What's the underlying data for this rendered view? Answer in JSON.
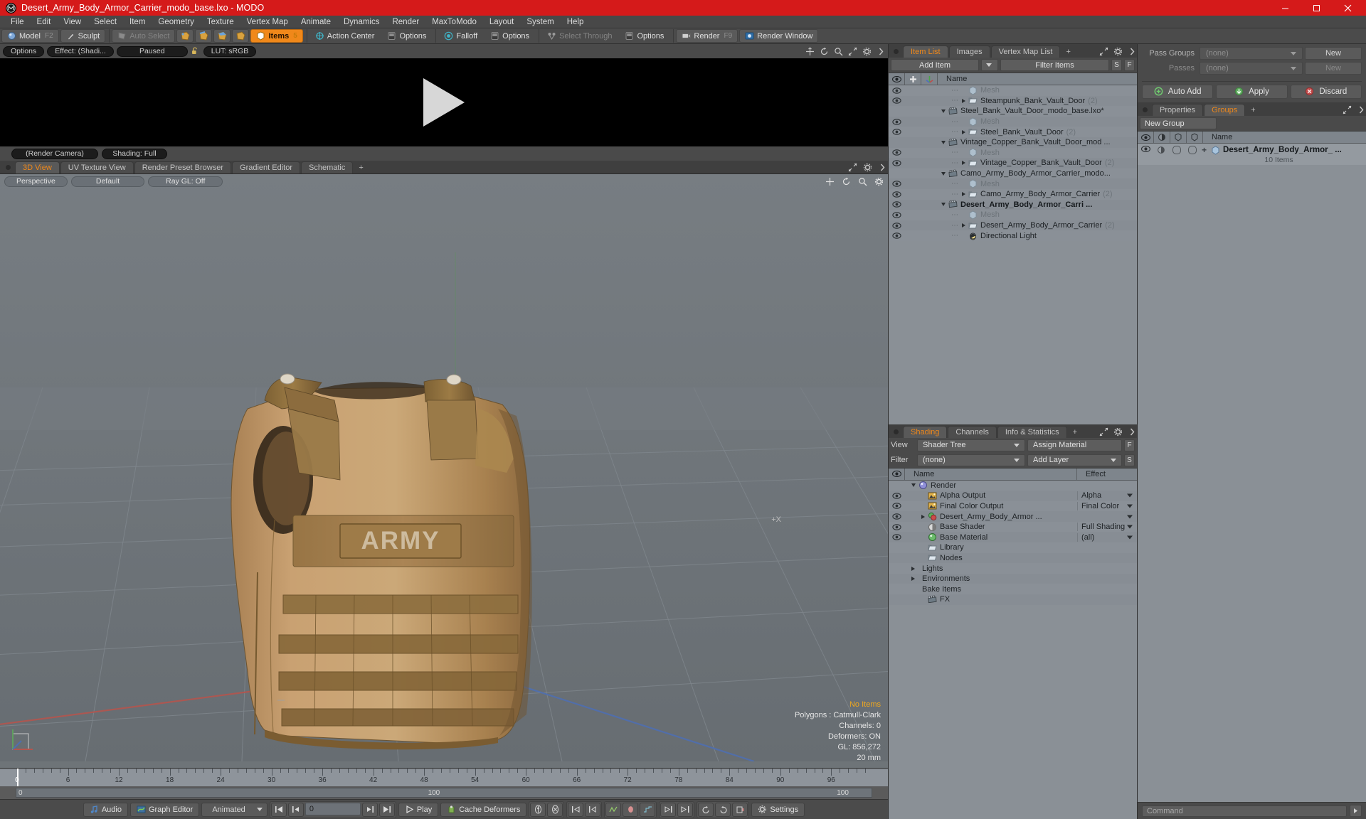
{
  "window": {
    "title": "Desert_Army_Body_Armor_Carrier_modo_base.lxo - MODO",
    "logo": "modo-logo-icon",
    "minimize": "minimize-button",
    "maximize": "maximize-button",
    "close": "close-button"
  },
  "menu": {
    "items": [
      {
        "label": "File"
      },
      {
        "label": "Edit"
      },
      {
        "label": "View"
      },
      {
        "label": "Select"
      },
      {
        "label": "Item"
      },
      {
        "label": "Geometry"
      },
      {
        "label": "Texture"
      },
      {
        "label": "Vertex Map"
      },
      {
        "label": "Animate"
      },
      {
        "label": "Dynamics"
      },
      {
        "label": "Render"
      },
      {
        "label": "MaxToModo"
      },
      {
        "label": "Layout"
      },
      {
        "label": "System"
      },
      {
        "label": "Help"
      }
    ]
  },
  "modebar": {
    "model": "Model",
    "model_key": "F2",
    "sculpt": "Sculpt",
    "auto_select": "Auto Select",
    "items": "Items",
    "items_key": "5",
    "action_center": "Action Center",
    "options1": "Options",
    "falloff": "Falloff",
    "options2": "Options",
    "select_through": "Select Through",
    "options3": "Options",
    "render": "Render",
    "render_key": "F9",
    "render_window": "Render Window"
  },
  "render_pane": {
    "options": "Options",
    "effect": "Effect: (Shadi...",
    "paused": "Paused",
    "lock_icon": "unlock-icon",
    "lut": "LUT: sRGB",
    "render_camera": "(Render Camera)",
    "shading": "Shading: Full"
  },
  "viewport_tabs": {
    "tabs": [
      {
        "label": "3D View",
        "active": true
      },
      {
        "label": "UV Texture View",
        "active": false
      },
      {
        "label": "Render Preset Browser",
        "active": false
      },
      {
        "label": "Gradient Editor",
        "active": false
      },
      {
        "label": "Schematic",
        "active": false
      }
    ],
    "add": "+"
  },
  "viewport": {
    "perspective": "Perspective",
    "default": "Default",
    "raygl": "Ray GL: Off",
    "plus_x": "+X",
    "stats": {
      "selection": "No Items",
      "polygons": "Polygons : Catmull-Clark",
      "channels": "Channels: 0",
      "deformers": "Deformers: ON",
      "gl": "GL: 856,272",
      "units": "20 mm"
    }
  },
  "timeline": {
    "ticks": [
      0,
      6,
      12,
      18,
      24,
      30,
      36,
      42,
      48,
      54,
      60,
      66,
      72,
      78,
      84,
      90,
      96
    ],
    "scroll_start": "0",
    "scroll_center": "100",
    "scroll_end": "100"
  },
  "transport": {
    "audio": "Audio",
    "graph_editor": "Graph Editor",
    "mode": "Animated",
    "frame_value": "0",
    "play": "Play",
    "cache_deformers": "Cache Deformers",
    "settings": "Settings"
  },
  "item_list": {
    "tabs": [
      {
        "label": "Item List",
        "active": true
      },
      {
        "label": "Images",
        "active": false
      },
      {
        "label": "Vertex Map List",
        "active": false
      }
    ],
    "add_tab": "+",
    "add_item": "Add Item",
    "filter_items": "Filter Items",
    "btn_s": "S",
    "btn_f": "F",
    "columns": {
      "eye": "visibility-column",
      "lock": "lock-column",
      "axis": "axis-column",
      "name": "Name"
    },
    "rows": [
      {
        "indent": 2,
        "label": "Mesh",
        "icon": "mesh-icon",
        "dim": true,
        "count": "",
        "toggle": "none",
        "eye": true
      },
      {
        "indent": 2,
        "label": "Steampunk_Bank_Vault_Door",
        "icon": "folder-icon",
        "dim": false,
        "count": "(2)",
        "toggle": "right",
        "eye": true
      },
      {
        "indent": 1,
        "label": "Steel_Bank_Vault_Door_modo_base.lxo*",
        "icon": "scene-icon",
        "dim": false,
        "count": "",
        "toggle": "down",
        "eye": false,
        "bold": false
      },
      {
        "indent": 2,
        "label": "Mesh",
        "icon": "mesh-icon",
        "dim": true,
        "count": "",
        "toggle": "none",
        "eye": true
      },
      {
        "indent": 2,
        "label": "Steel_Bank_Vault_Door",
        "icon": "folder-icon",
        "dim": false,
        "count": "(2)",
        "toggle": "right",
        "eye": true
      },
      {
        "indent": 1,
        "label": "Vintage_Copper_Bank_Vault_Door_mod ...",
        "icon": "scene-icon",
        "dim": false,
        "count": "",
        "toggle": "down",
        "eye": false
      },
      {
        "indent": 2,
        "label": "Mesh",
        "icon": "mesh-icon",
        "dim": true,
        "count": "",
        "toggle": "none",
        "eye": true
      },
      {
        "indent": 2,
        "label": "Vintage_Copper_Bank_Vault_Door",
        "icon": "folder-icon",
        "dim": false,
        "count": "(2)",
        "toggle": "right",
        "eye": true
      },
      {
        "indent": 1,
        "label": "Camo_Army_Body_Armor_Carrier_modo...",
        "icon": "scene-icon",
        "dim": false,
        "count": "",
        "toggle": "down",
        "eye": false
      },
      {
        "indent": 2,
        "label": "Mesh",
        "icon": "mesh-icon",
        "dim": true,
        "count": "",
        "toggle": "none",
        "eye": true
      },
      {
        "indent": 2,
        "label": "Camo_Army_Body_Armor_Carrier",
        "icon": "folder-icon",
        "dim": false,
        "count": "(2)",
        "toggle": "right",
        "eye": true
      },
      {
        "indent": 1,
        "label": "Desert_Army_Body_Armor_Carri ...",
        "icon": "scene-icon",
        "dim": false,
        "count": "",
        "toggle": "down",
        "eye": true,
        "bold": true
      },
      {
        "indent": 2,
        "label": "Mesh",
        "icon": "mesh-icon",
        "dim": true,
        "count": "",
        "toggle": "none",
        "eye": true
      },
      {
        "indent": 2,
        "label": "Desert_Army_Body_Armor_Carrier",
        "icon": "folder-icon",
        "dim": false,
        "count": "(2)",
        "toggle": "right",
        "eye": true
      },
      {
        "indent": 2,
        "label": "Directional Light",
        "icon": "light-icon",
        "dim": false,
        "count": "",
        "toggle": "none",
        "eye": true
      }
    ]
  },
  "shading": {
    "tabs": [
      {
        "label": "Shading",
        "active": true
      },
      {
        "label": "Channels",
        "active": false
      },
      {
        "label": "Info & Statistics",
        "active": false
      }
    ],
    "add_tab": "+",
    "view_label": "View",
    "view_value": "Shader Tree",
    "assign_material": "Assign Material",
    "btn_f": "F",
    "filter_label": "Filter",
    "filter_value": "(none)",
    "add_layer": "Add Layer",
    "btn_s": "S",
    "col_name": "Name",
    "col_effect": "Effect",
    "rows": [
      {
        "indent": 1,
        "label": "Render",
        "icon": "render-sphere-icon",
        "effect": "",
        "toggle": "down",
        "eye": false
      },
      {
        "indent": 2,
        "label": "Alpha Output",
        "icon": "image-output-icon",
        "effect": "Alpha",
        "toggle": "none",
        "eye": true
      },
      {
        "indent": 2,
        "label": "Final Color Output",
        "icon": "image-output-icon",
        "effect": "Final Color",
        "toggle": "none",
        "eye": true
      },
      {
        "indent": 2,
        "label": "Desert_Army_Body_Armor ...",
        "icon": "material-group-icon",
        "effect": "",
        "toggle": "right",
        "eye": true
      },
      {
        "indent": 2,
        "label": "Base Shader",
        "icon": "shader-icon",
        "effect": "Full Shading",
        "toggle": "none",
        "eye": true
      },
      {
        "indent": 2,
        "label": "Base Material",
        "icon": "material-icon",
        "effect": "(all)",
        "toggle": "none",
        "eye": true
      },
      {
        "indent": 2,
        "label": "Library",
        "icon": "folder-icon",
        "effect": "",
        "toggle": "none",
        "eye": false
      },
      {
        "indent": 2,
        "label": "Nodes",
        "icon": "folder-icon",
        "effect": "",
        "toggle": "none",
        "eye": false
      },
      {
        "indent": 1,
        "label": "Lights",
        "icon": "none",
        "effect": "",
        "toggle": "right",
        "eye": false
      },
      {
        "indent": 1,
        "label": "Environments",
        "icon": "none",
        "effect": "",
        "toggle": "right",
        "eye": false
      },
      {
        "indent": 1,
        "label": "Bake Items",
        "icon": "none",
        "effect": "",
        "toggle": "none",
        "eye": false
      },
      {
        "indent": 2,
        "label": "FX",
        "icon": "scene-icon",
        "effect": "",
        "toggle": "none",
        "eye": false
      }
    ]
  },
  "passes": {
    "pass_groups_label": "Pass Groups",
    "pass_groups_value": "(none)",
    "pass_groups_new": "New",
    "passes_label": "Passes",
    "passes_value": "(none)",
    "passes_new": "New",
    "auto_add": "Auto Add",
    "apply": "Apply",
    "discard": "Discard"
  },
  "groups": {
    "tabs": [
      {
        "label": "Properties",
        "active": false
      },
      {
        "label": "Groups",
        "active": true
      }
    ],
    "add_tab": "+",
    "new_group": "New Group",
    "col_name": "Name",
    "row": {
      "name": "Desert_Army_Body_Armor_ ...",
      "sub": "10 Items",
      "plus": "+"
    }
  },
  "command": {
    "placeholder": "Command"
  },
  "colors": {
    "title_bar": "#d51a1a",
    "accent_orange": "#f0881a",
    "panel_bg": "#4a4a4a",
    "list_bg": "#8a9096",
    "viewport_bg": "#6e7478",
    "vest_tan": "#c29a6d"
  }
}
